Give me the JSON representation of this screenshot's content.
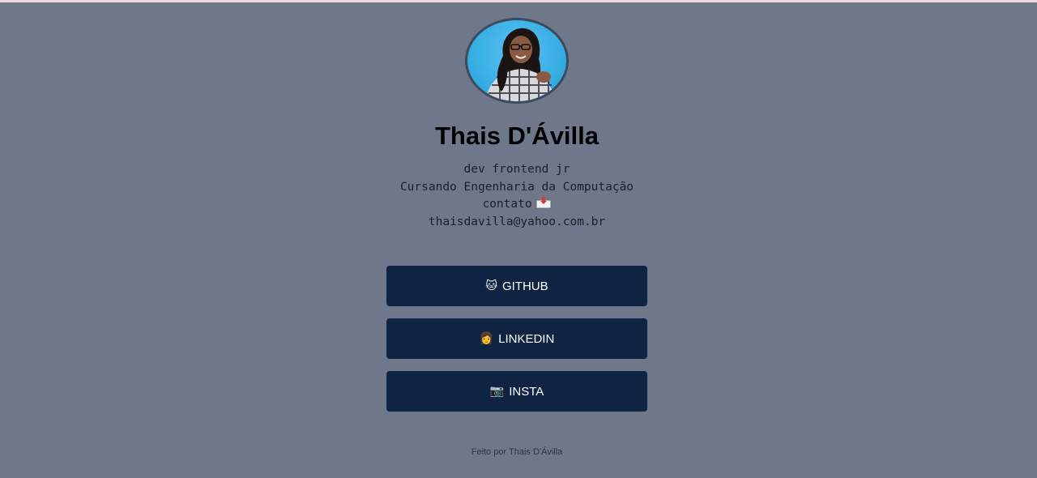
{
  "profile": {
    "name": "Thais D'Ávilla",
    "bio_line1": "dev frontend jr",
    "bio_line2": "Cursando Engenharia da Computação",
    "bio_line3": "contato",
    "email": "thaisdavilla@yahoo.com.br"
  },
  "links": [
    {
      "icon": "🐱",
      "label": "GITHUB"
    },
    {
      "icon": "👩",
      "label": "LINKEDIN"
    },
    {
      "icon": "📷",
      "label": "INSTA"
    }
  ],
  "footer": {
    "text": "Feito por Thais D'Ávilla"
  },
  "colors": {
    "background": "#6f788b",
    "button": "#0f2443",
    "top_strip": "#f3d6d8"
  }
}
